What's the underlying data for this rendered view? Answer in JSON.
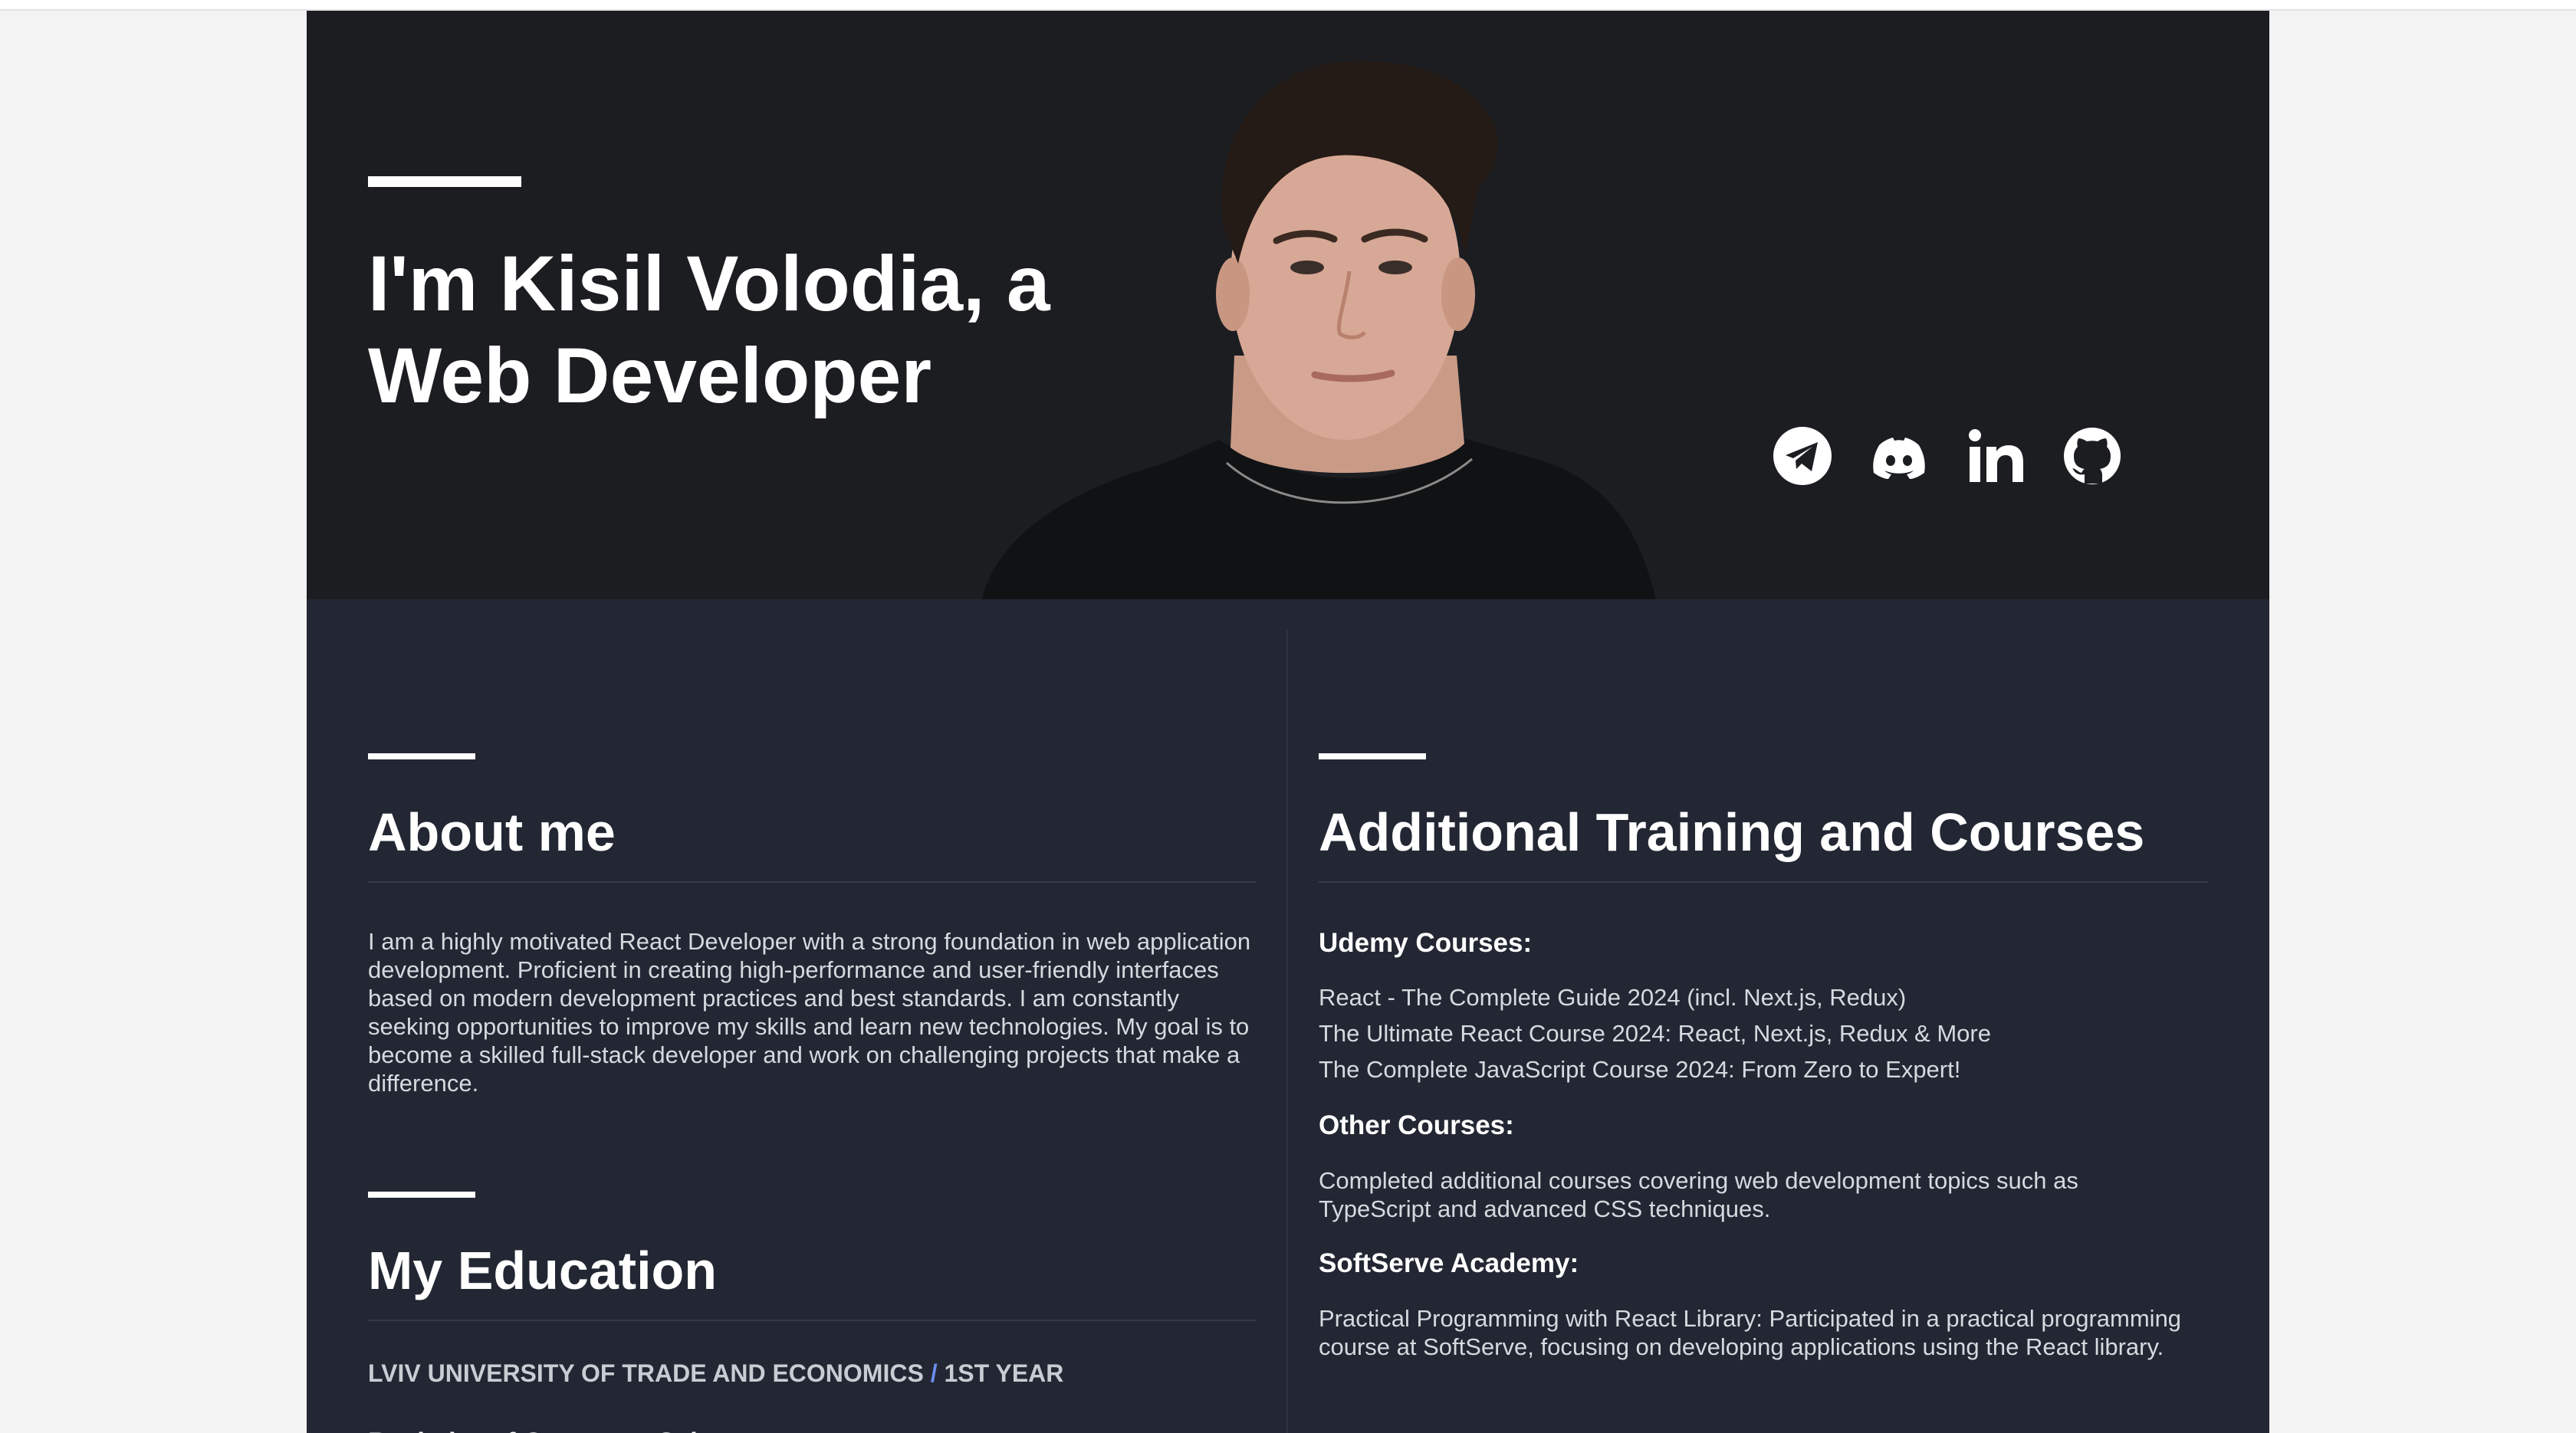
{
  "hero": {
    "title": "I'm Kisil Volodia, a Web Developer"
  },
  "socials": [
    {
      "icon": "telegram-icon"
    },
    {
      "icon": "discord-icon"
    },
    {
      "icon": "linkedin-icon"
    },
    {
      "icon": "github-icon"
    }
  ],
  "about": {
    "title": "About me",
    "text": "I am a highly motivated React Developer with a strong foundation in web application development. Proficient in creating high-performance and user-friendly interfaces based on modern development practices and best standards. I am constantly seeking opportunities to improve my skills and learn new technologies. My goal is to become a skilled full-stack developer and work on challenging projects that make a difference."
  },
  "education": {
    "title": "My Education",
    "university": "LVIV UNIVERSITY OF TRADE AND ECONOMICS",
    "separator": "/",
    "year": "1ST YEAR",
    "degree": "Bachelor of Computer Science"
  },
  "training": {
    "title": "Additional Training and Courses",
    "udemy_title": "Udemy Courses:",
    "udemy_courses": [
      "React - The Complete Guide 2024 (incl. Next.js, Redux)",
      "The Ultimate React Course 2024: React, Next.js, Redux & More",
      "The Complete JavaScript Course 2024: From Zero to Expert!"
    ],
    "other_title": "Other Courses:",
    "other_text": "Completed additional courses covering web development topics such as TypeScript and advanced CSS techniques.",
    "softserve_title": "SoftServe Academy:",
    "softserve_text": "Practical Programming with React Library: Participated in a practical programming course at SoftServe, focusing on developing applications using the React library."
  },
  "colors": {
    "hero_bg": "#1b1d21",
    "content_bg": "#222733",
    "page_bg": "#f3f3f3",
    "accent_separator": "#6b8ff0"
  }
}
